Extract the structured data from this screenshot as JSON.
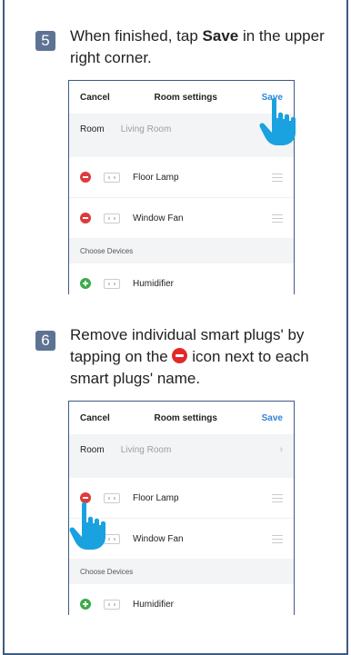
{
  "step5": {
    "number": "5",
    "text_before": "When finished, tap ",
    "text_bold": "Save",
    "text_after": " in the upper right corner."
  },
  "step6": {
    "number": "6",
    "text_before": "Remove individual smart plugs' by tapping on the ",
    "text_after": " icon next to each smart plugs' name."
  },
  "screen1": {
    "cancel": "Cancel",
    "title": "Room settings",
    "save": "Save",
    "room_label": "Room",
    "room_value": "Living Room",
    "devices": [
      {
        "name": "Floor Lamp"
      },
      {
        "name": "Window Fan"
      }
    ],
    "choose_header": "Choose Devices",
    "available": [
      {
        "name": "Humidifier"
      }
    ]
  },
  "screen2": {
    "cancel": "Cancel",
    "title": "Room settings",
    "save": "Save",
    "room_label": "Room",
    "room_value": "Living Room",
    "chevron": "›",
    "devices": [
      {
        "name": "Floor Lamp"
      },
      {
        "name": "Window Fan"
      }
    ],
    "choose_header": "Choose Devices",
    "available": [
      {
        "name": "Humidifier"
      }
    ]
  },
  "colors": {
    "accent": "#2f86d6",
    "step_badge": "#5d7394",
    "remove": "#e03a3a",
    "add": "#3daa49",
    "hand": "#1aa1e0",
    "frame": "#3e5a84"
  },
  "icons": {
    "remove": "minus-circle-icon",
    "add": "plus-circle-icon",
    "plug": "smart-plug-icon",
    "drag": "drag-handle-icon",
    "pointer": "pointing-hand-icon"
  }
}
